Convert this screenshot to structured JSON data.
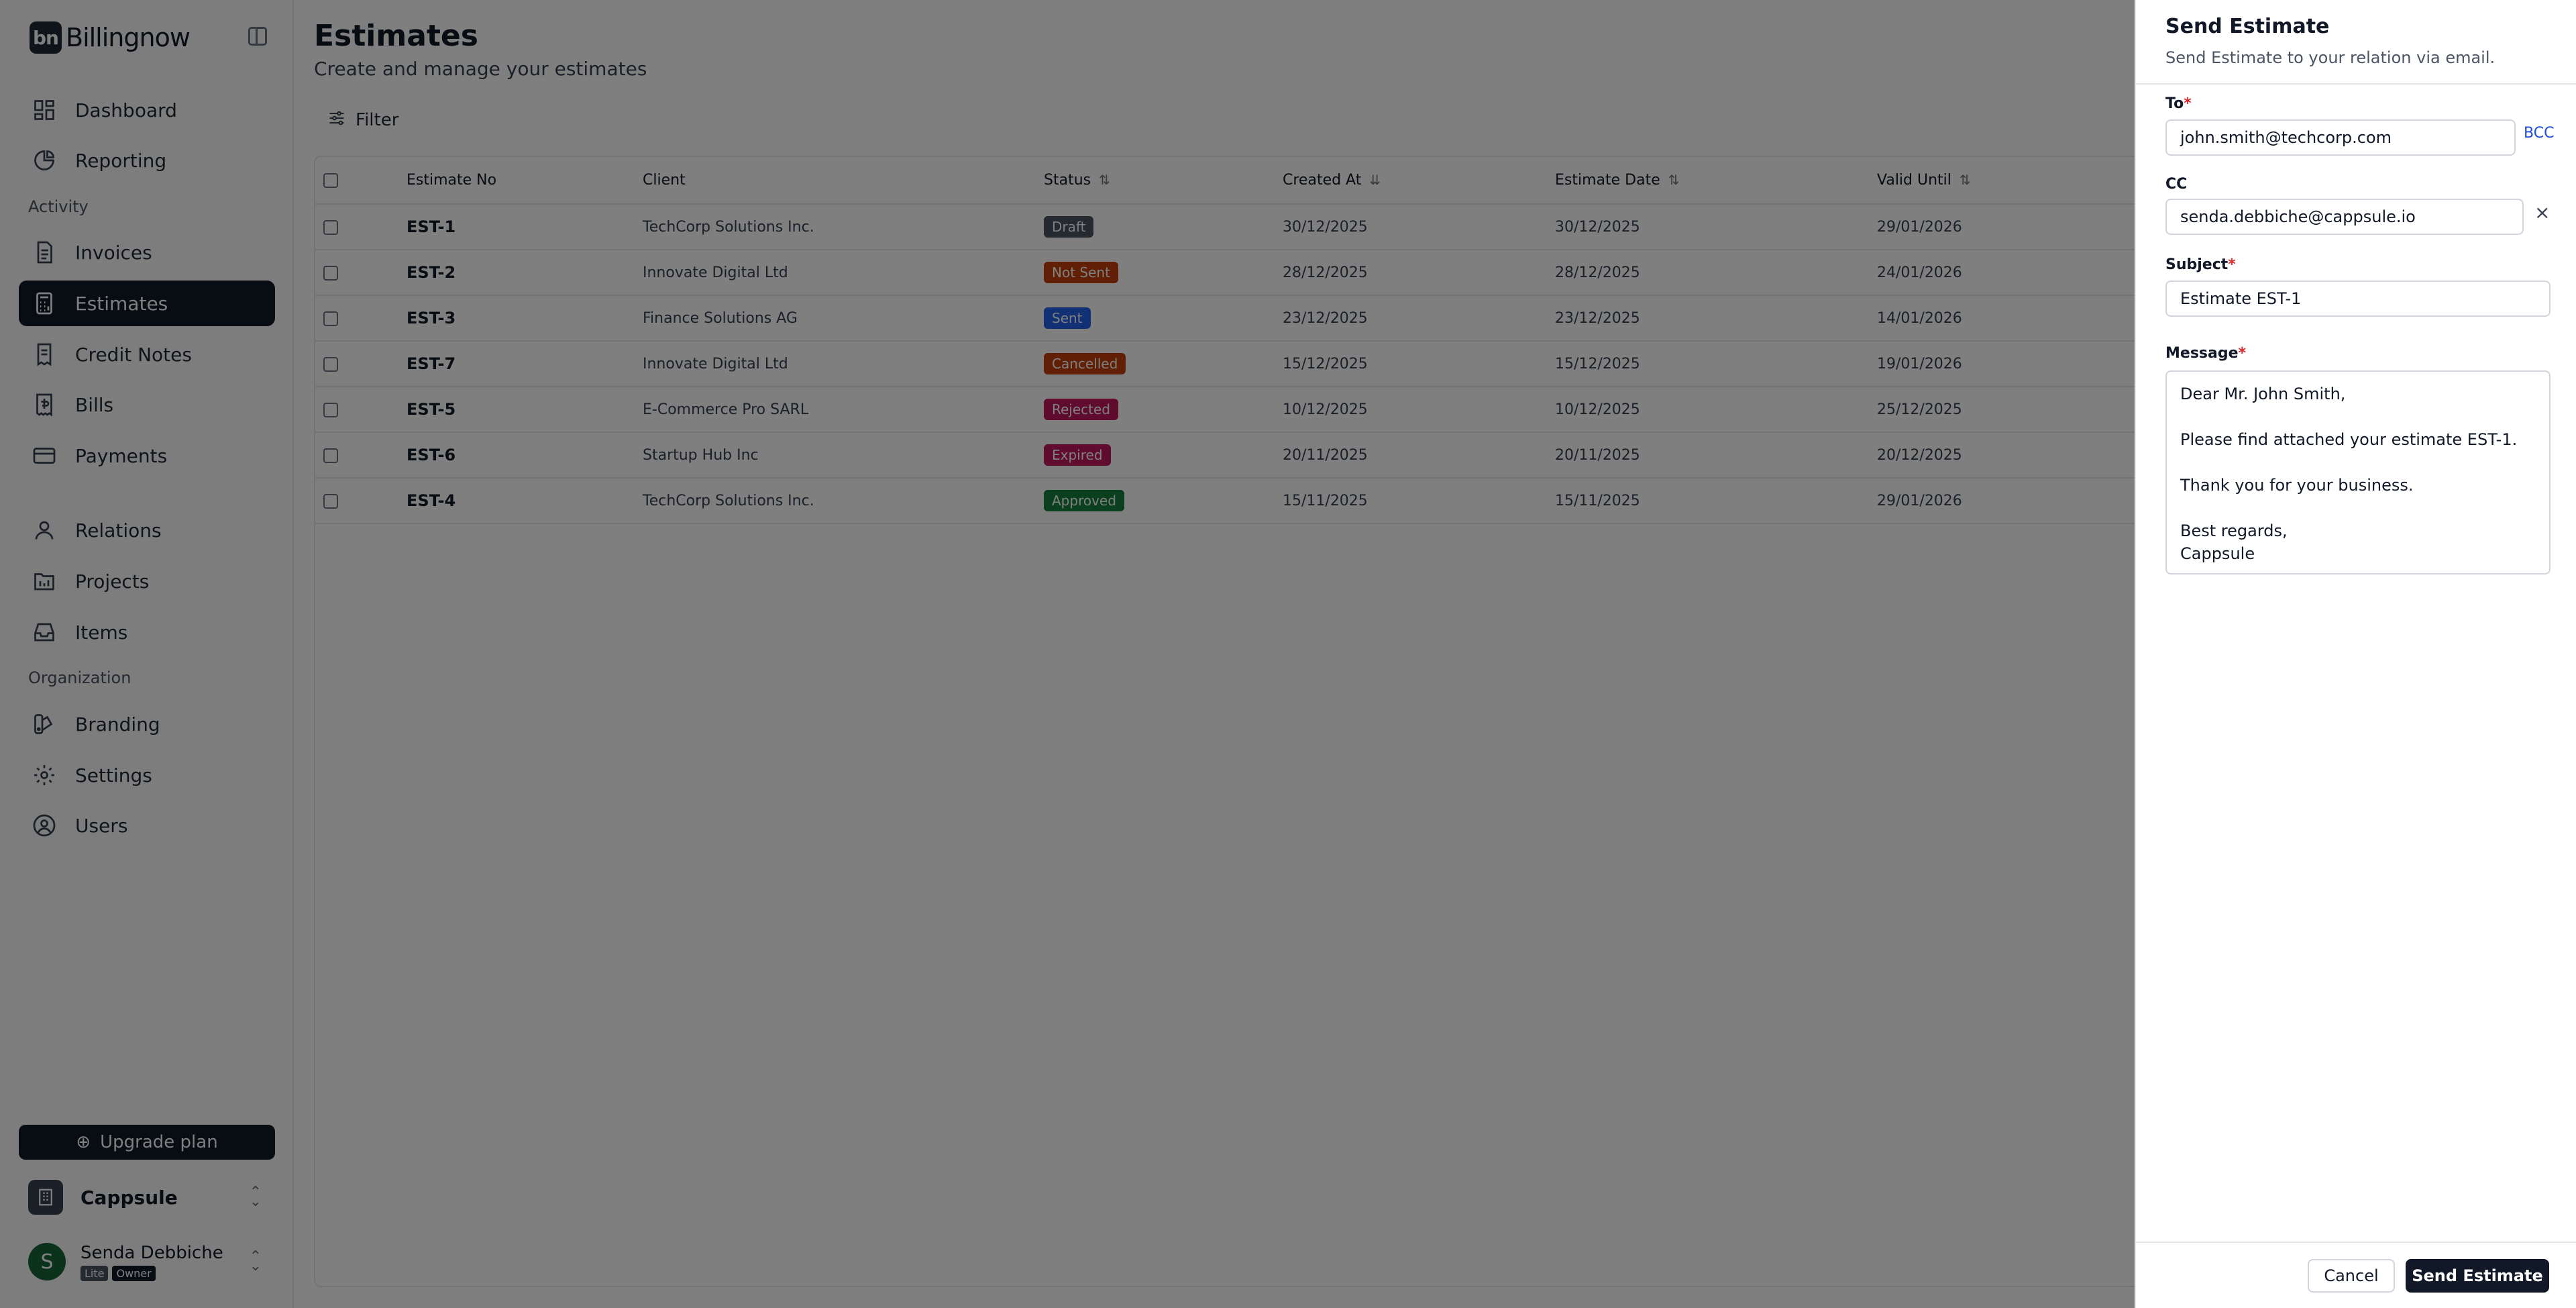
{
  "app": {
    "brand_mark": "bn",
    "brand_name": "Billingnow"
  },
  "sidebar": {
    "items": [
      {
        "label": "Dashboard",
        "icon": "dashboard-icon"
      },
      {
        "label": "Reporting",
        "icon": "pie-chart-icon"
      },
      {
        "label": "Invoices",
        "icon": "document-icon"
      },
      {
        "label": "Estimates",
        "icon": "calculator-icon",
        "active": true
      },
      {
        "label": "Credit Notes",
        "icon": "receipt-icon"
      },
      {
        "label": "Bills",
        "icon": "bill-icon"
      },
      {
        "label": "Payments",
        "icon": "credit-card-icon"
      },
      {
        "label": "Relations",
        "icon": "user-icon"
      },
      {
        "label": "Projects",
        "icon": "folder-icon"
      },
      {
        "label": "Items",
        "icon": "inbox-icon"
      },
      {
        "label": "Branding",
        "icon": "palette-icon"
      },
      {
        "label": "Settings",
        "icon": "gear-icon"
      },
      {
        "label": "Users",
        "icon": "user-circle-icon"
      }
    ],
    "sections": {
      "activity": "Activity",
      "organization": "Organization"
    },
    "upgrade_label": "Upgrade plan",
    "org_name": "Cappsule",
    "user": {
      "initial": "S",
      "name": "Senda Debbiche",
      "tags": [
        "Lite",
        "Owner"
      ]
    }
  },
  "main": {
    "title": "Estimates",
    "subtitle": "Create and manage your estimates",
    "filter_label": "Filter",
    "columns": [
      "Estimate No",
      "Client",
      "Status",
      "Created At",
      "Estimate Date",
      "Valid Until"
    ],
    "rows": [
      {
        "no": "EST-1",
        "client": "TechCorp Solutions Inc.",
        "status": "Draft",
        "status_color": "#4b5563",
        "created": "30/12/2025",
        "date": "30/12/2025",
        "valid": "29/01/2026"
      },
      {
        "no": "EST-2",
        "client": "Innovate Digital Ltd",
        "status": "Not Sent",
        "status_color": "#c2410c",
        "created": "28/12/2025",
        "date": "28/12/2025",
        "valid": "24/01/2026"
      },
      {
        "no": "EST-3",
        "client": "Finance Solutions AG",
        "status": "Sent",
        "status_color": "#2563eb",
        "created": "23/12/2025",
        "date": "23/12/2025",
        "valid": "14/01/2026"
      },
      {
        "no": "EST-7",
        "client": "Innovate Digital Ltd",
        "status": "Cancelled",
        "status_color": "#c2410c",
        "created": "15/12/2025",
        "date": "15/12/2025",
        "valid": "19/01/2026"
      },
      {
        "no": "EST-5",
        "client": "E-Commerce Pro SARL",
        "status": "Rejected",
        "status_color": "#be185d",
        "created": "10/12/2025",
        "date": "10/12/2025",
        "valid": "25/12/2025"
      },
      {
        "no": "EST-6",
        "client": "Startup Hub Inc",
        "status": "Expired",
        "status_color": "#be185d",
        "created": "20/11/2025",
        "date": "20/11/2025",
        "valid": "20/12/2025"
      },
      {
        "no": "EST-4",
        "client": "TechCorp Solutions Inc.",
        "status": "Approved",
        "status_color": "#15803d",
        "created": "15/11/2025",
        "date": "15/11/2025",
        "valid": "29/01/2026"
      }
    ]
  },
  "drawer": {
    "title": "Send Estimate",
    "subtitle": "Send Estimate to your relation via email.",
    "to_label": "To",
    "to_value": "john.smith@techcorp.com",
    "bcc_label": "BCC",
    "cc_label": "CC",
    "cc_value": "senda.debbiche@cappsule.io",
    "subject_label": "Subject",
    "subject_value": "Estimate EST-1",
    "message_label": "Message",
    "message_value": "Dear Mr. John Smith,\n\nPlease find attached your estimate EST-1.\n\nThank you for your business.\n\nBest regards,\nCappsule",
    "cancel_label": "Cancel",
    "send_label": "Send Estimate"
  }
}
